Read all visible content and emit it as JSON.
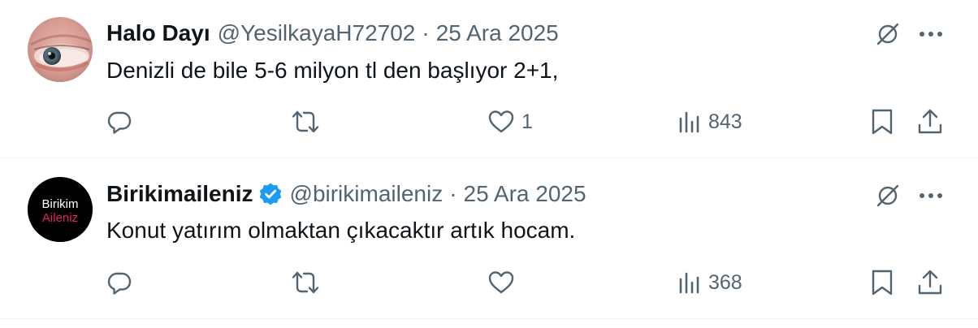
{
  "tweets": [
    {
      "display_name": "Halo Dayı",
      "handle": "@YesilkayaH72702",
      "separator": "·",
      "date": "25 Ara 2025",
      "verified": false,
      "text": "Denizli de bile 5-6 milyon tl den başlıyor 2+1,",
      "avatar_icon": "eye-photo-avatar",
      "counts": {
        "replies": "",
        "retweets": "",
        "likes": "1",
        "views": "843"
      }
    },
    {
      "display_name": "Birikimaileniz",
      "handle": "@birikimaileniz",
      "separator": "·",
      "date": "25 Ara 2025",
      "verified": true,
      "text": "Konut yatırım olmaktan çıkacaktır artık hocam.",
      "avatar_lines": [
        "Birikim",
        "Aileniz"
      ],
      "counts": {
        "replies": "",
        "retweets": "",
        "likes": "",
        "views": "368"
      }
    }
  ],
  "icons": {
    "reply": "reply-icon",
    "retweet": "retweet-icon",
    "like": "heart-icon",
    "views": "views-icon",
    "bookmark": "bookmark-icon",
    "share": "share-icon",
    "grok": "grok-icon",
    "more": "more-icon",
    "verified": "verified-badge-icon"
  },
  "colors": {
    "text_primary": "#0f1419",
    "text_secondary": "#536471",
    "verified_blue": "#1d9bf0",
    "avatar_red_text": "#e0245e",
    "divider": "#eff3f4"
  }
}
